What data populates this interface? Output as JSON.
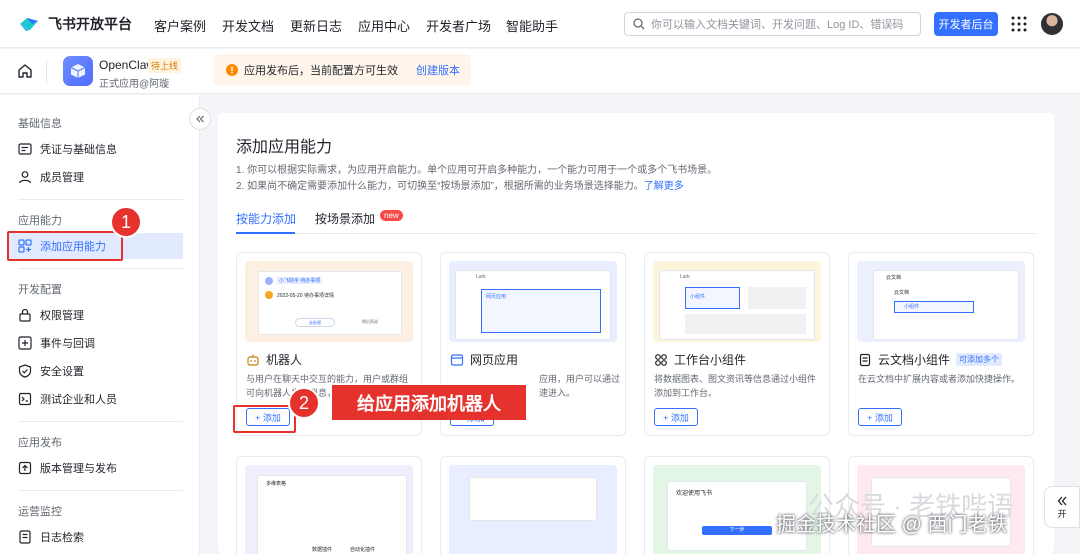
{
  "brand": {
    "name": "飞书开放平台"
  },
  "nav": [
    "客户案例",
    "开发文档",
    "更新日志",
    "应用中心",
    "开发者广场",
    "智能助手"
  ],
  "search": {
    "placeholder": "你可以输入文档关键词、开发问题、Log ID、错误码"
  },
  "header": {
    "console_label": "开发者后台"
  },
  "app": {
    "name": "OpenClaw",
    "status": "待上线",
    "subtitle": "正式应用@阿璇"
  },
  "notice": {
    "text": "应用发布后，当前配置方可生效",
    "link": "创建版本"
  },
  "sidebar": {
    "sections": [
      {
        "title": "基础信息",
        "items": [
          "凭证与基础信息",
          "成员管理"
        ]
      },
      {
        "title": "应用能力",
        "items": [
          "添加应用能力"
        ]
      },
      {
        "title": "开发配置",
        "items": [
          "权限管理",
          "事件与回调",
          "安全设置",
          "测试企业和人员"
        ]
      },
      {
        "title": "应用发布",
        "items": [
          "版本管理与发布"
        ]
      },
      {
        "title": "运营监控",
        "items": [
          "日志检索"
        ]
      }
    ]
  },
  "main": {
    "title": "添加应用能力",
    "desc1": "1. 你可以根据实际需求，为应用开启能力。单个应用可开启多种能力，一个能力可用于一个或多个飞书场景。",
    "desc2": "2. 如果尚不确定需要添加什么能力，可切换至“按场景添加”，根据所需的业务场景选择能力。",
    "desc2_link": "了解更多",
    "tabs": [
      "按能力添加",
      "按场景添加"
    ],
    "new_badge": "new",
    "cards": [
      {
        "title": "机器人",
        "desc": "与用户在聊天中交互的能力，用户或群组可向机器人发送消息，",
        "add": "+ 添加",
        "preview_text": [
          "小飞助手 待办事项",
          "2022-05-20 待办事项详情",
          "去处理",
          "稍后再说"
        ]
      },
      {
        "title": "网页应用",
        "desc": "应用，用户可以通过",
        "desc2": "速进入。",
        "add": "+ 添加",
        "preview_text": [
          "Lark",
          "网页应用"
        ]
      },
      {
        "title": "工作台小组件",
        "desc": "将数据图表、图文资讯等信息通过小组件添加到工作台。",
        "add": "+ 添加",
        "preview_text": [
          "Lark",
          "小组件"
        ]
      },
      {
        "title": "云文档小组件",
        "tag": "可添加多个",
        "desc": "在云文档中扩展内容或者添加快捷操作。",
        "add": "+ 添加",
        "preview_text": [
          "云文档",
          "云文档",
          "小组件"
        ]
      }
    ],
    "row2_preview_text": [
      "多维表格",
      "数据插件",
      "自动化插件",
      "欢迎使用飞书",
      "下一步"
    ]
  },
  "annotations": {
    "step1": "1",
    "step2": "2",
    "callout": "给应用添加机器人"
  },
  "watermark": {
    "line1": "公众号 · 老铁哔语",
    "line2": "掘金技术社区 @ 西门老铁"
  },
  "float": {
    "label": "开"
  },
  "colors": {
    "accent": "#3370ff",
    "annotation_red": "#e5322d"
  }
}
